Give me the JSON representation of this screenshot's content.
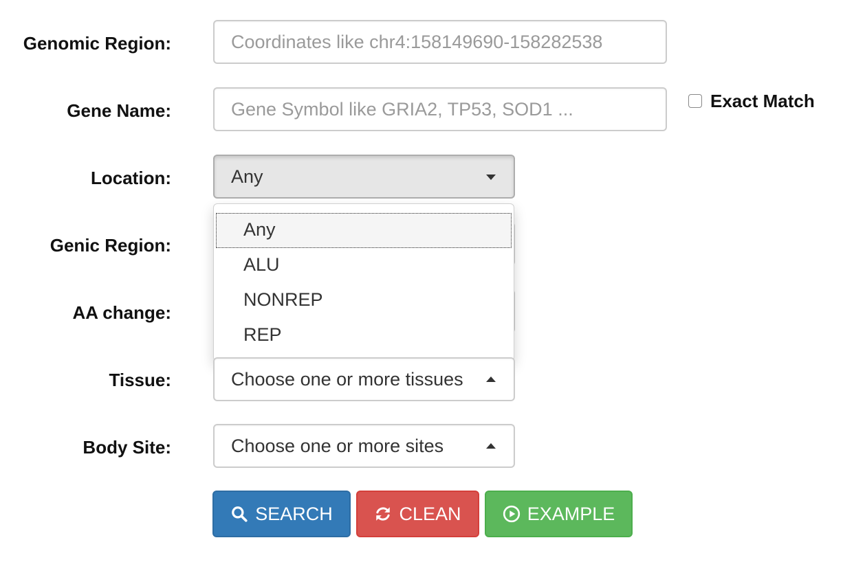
{
  "form": {
    "genomic_region": {
      "label": "Genomic Region:",
      "placeholder": "Coordinates like chr4:158149690-158282538"
    },
    "gene_name": {
      "label": "Gene Name:",
      "placeholder": "Gene Symbol like GRIA2, TP53, SOD1 ...",
      "exact_match_label": "Exact Match"
    },
    "location": {
      "label": "Location:",
      "selected": "Any",
      "options": [
        "Any",
        "ALU",
        "NONREP",
        "REP"
      ]
    },
    "genic_region": {
      "label": "Genic Region:"
    },
    "aa_change": {
      "label": "AA change:"
    },
    "tissue": {
      "label": "Tissue:",
      "placeholder": "Choose one or more tissues"
    },
    "body_site": {
      "label": "Body Site:",
      "placeholder": "Choose one or more sites"
    }
  },
  "buttons": {
    "search": "SEARCH",
    "clean": "CLEAN",
    "example": "EXAMPLE"
  },
  "colors": {
    "search": "#337ab7",
    "clean": "#d9534f",
    "example": "#5cb85c"
  },
  "icons": {
    "search": "search-icon",
    "clean": "refresh-icon",
    "example": "play-circle-icon",
    "dropdown": "caret-icon"
  }
}
